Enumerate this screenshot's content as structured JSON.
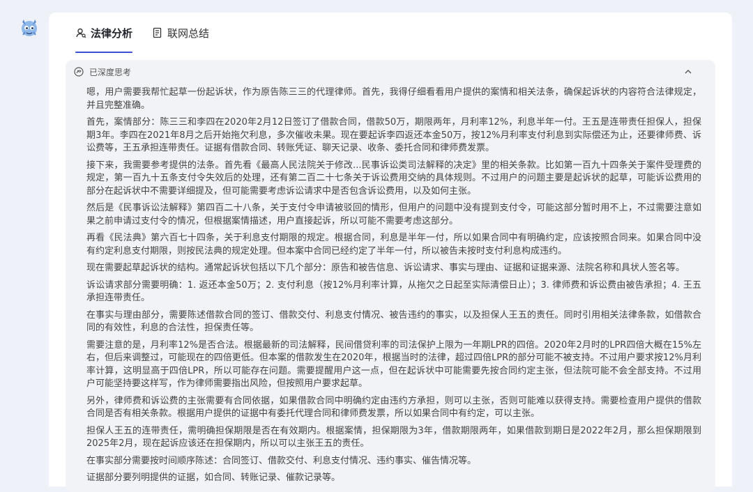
{
  "app": {
    "logo_icon": "dragon-mascot-icon"
  },
  "tabs": [
    {
      "label": "法律分析",
      "icon": "person-search-icon",
      "active": true
    },
    {
      "label": "联网总结",
      "icon": "document-list-icon",
      "active": false
    }
  ],
  "thinking": {
    "header_label": "已深度思考",
    "header_icon": "deep-think-icon",
    "collapse_icon": "chevron-up-icon",
    "paragraphs": [
      "嗯，用户需要我帮忙起草一份起诉状，作为原告陈三三的代理律师。首先，我得仔细看看用户提供的案情和相关法条，确保起诉状的内容符合法律规定，并且完整准确。",
      "首先，案情部分：陈三三和李四在2020年2月12日签订了借款合同，借款50万，期限两年，月利率12%，利息半年一付。王五是连带责任担保人，担保期3年。李四在2021年8月之后开始拖欠利息，多次催收未果。现在要起诉李四返还本金50万，按12%月利率支付利息到实际偿还为止，还要律师费、诉讼费等，王五承担连带责任。证据有借款合同、转账凭证、聊天记录、收条、委托合同和律师费发票。",
      "接下来，我需要参考提供的法条。首先看《最高人民法院关于修改...民事诉讼类司法解释的决定》里的相关条款。比如第一百九十四条关于案件受理费的规定，第一百九十五条支付令失效后的处理，还有第二百二十七条关于诉讼费用交纳的具体规则。不过用户的问题主要是起诉状的起草，可能诉讼费用的部分在起诉状中不需要详细提及，但可能需要考虑诉讼请求中是否包含诉讼费用，以及如何主张。",
      "然后是《民事诉讼法解释》第四百二十八条，关于支付令申请被驳回的情形，但用户的问题中没有提到支付令，可能这部分暂时用不上，不过需要注意如果之前申请过支付令的情况，但根据案情描述，用户直接起诉，所以可能不需要考虑这部分。",
      "再看《民法典》第六百七十四条，关于利息支付期限的规定。根据合同，利息是半年一付，所以如果合同中有明确约定，应该按照合同来。如果合同中没有约定利息支付期限，则按民法典的规定处理。但本案中合同已经约定了半年一付，所以被告未按时支付利息构成违约。",
      "现在需要起草起诉状的结构。通常起诉状包括以下几个部分：原告和被告信息、诉讼请求、事实与理由、证据和证据来源、法院名称和具状人签名等。",
      "诉讼请求部分需要明确：1. 返还本金50万；2. 支付利息（按12%月利率计算，从拖欠之日起至实际清偿日止）；3. 律师费和诉讼费由被告承担；4. 王五承担连带责任。",
      "在事实与理由部分，需要陈述借款合同的签订、借款交付、利息支付情况、被告违约的事实，以及担保人王五的责任。同时引用相关法律条款，如借款合同的有效性，利息的合法性，担保责任等。",
      "需要注意的是，月利率12%是否合法。根据最新的司法解释，民间借贷利率的司法保护上限为一年期LPR的四倍。2020年2月时的LPR四倍大概在15%左右，但后来调整过，可能现在的四倍更低。但本案的借款发生在2020年，根据当时的法律，超过四倍LPR的部分可能不被支持。不过用户要求按12%月利率计算，这明显高于四倍LPR，所以可能存在问题。需要提醒用户这一点，但在起诉状中可能需要先按合同约定主张，但法院可能不会全部支持。不过用户可能坚持要这样写，作为律师需要指出风险，但按照用户要求起草。",
      "另外，律师费和诉讼费的主张需要有合同依据，如果借款合同中明确约定由违约方承担，则可以主张，否则可能难以获得支持。需要检查用户提供的借款合同是否有相关条款。根据用户提供的证据中有委托代理合同和律师费发票，所以如果合同中有约定，可以主张。",
      "担保人王五的连带责任，需明确担保期限是否在有效期内。根据案情，担保期限为3年，借款期限两年，如果借款到期日是2022年2月，那么担保期限到2025年2月，现在起诉应该还在担保期内，所以可以主张王五的责任。",
      "在事实部分需要按时间顺序陈述：合同签订、借款交付、利息支付情况、违约事实、催告情况等。",
      "证据部分要列明提供的证据，如合同、转账记录、催款记录等。"
    ]
  }
}
